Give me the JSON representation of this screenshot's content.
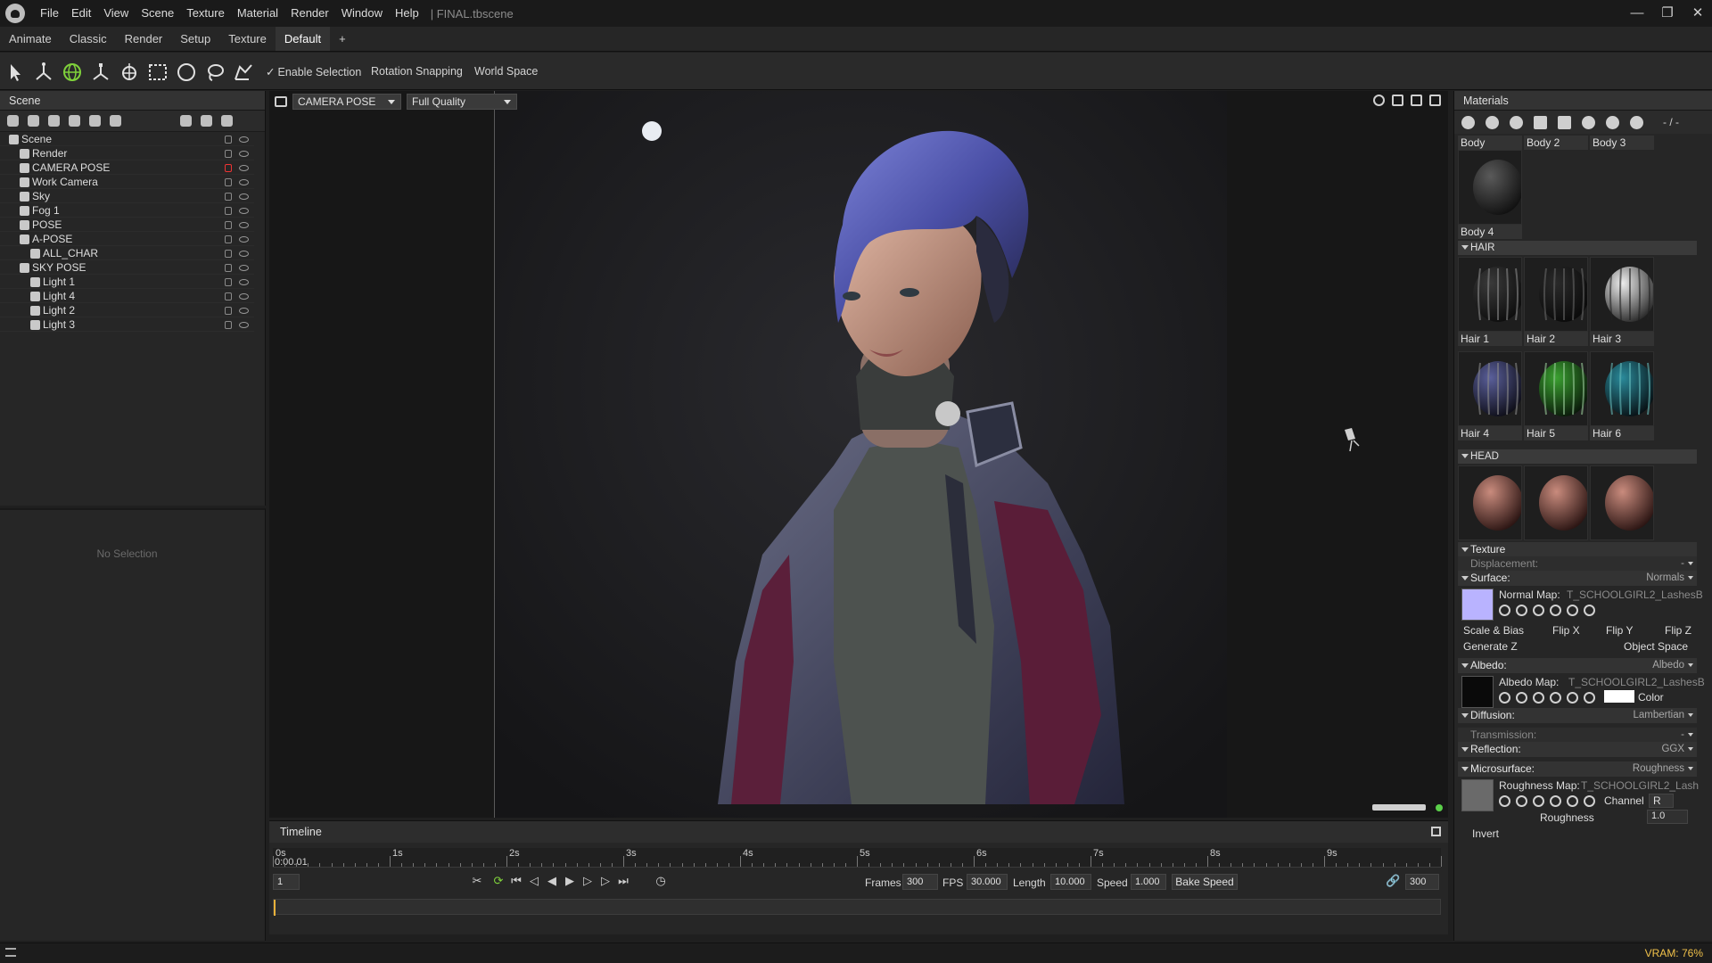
{
  "window": {
    "file_title": "| FINAL.tbscene",
    "menu": [
      "File",
      "Edit",
      "View",
      "Scene",
      "Texture",
      "Material",
      "Render",
      "Window",
      "Help"
    ]
  },
  "workspaces": [
    "Animate",
    "Classic",
    "Render",
    "Setup",
    "Texture",
    "Default",
    "+"
  ],
  "toolbar": {
    "enable_selection": "Enable Selection",
    "rotation_snapping": "Rotation Snapping",
    "world_space": "World Space"
  },
  "scene": {
    "title": "Scene",
    "items": [
      {
        "label": "Scene",
        "indent": 0,
        "lock": "normal"
      },
      {
        "label": "Render",
        "indent": 1,
        "lock": "normal"
      },
      {
        "label": "CAMERA POSE",
        "indent": 1,
        "lock": "red"
      },
      {
        "label": "Work Camera",
        "indent": 1,
        "lock": "normal"
      },
      {
        "label": "Sky",
        "indent": 1,
        "lock": "normal"
      },
      {
        "label": "Fog 1",
        "indent": 1,
        "lock": "normal"
      },
      {
        "label": "POSE",
        "indent": 1,
        "lock": "normal"
      },
      {
        "label": "A-POSE",
        "indent": 1,
        "lock": "normal"
      },
      {
        "label": "ALL_CHAR",
        "indent": 2,
        "lock": "normal"
      },
      {
        "label": "SKY POSE",
        "indent": 1,
        "lock": "normal"
      },
      {
        "label": "Light 1",
        "indent": 2,
        "lock": "normal"
      },
      {
        "label": "Light 4",
        "indent": 2,
        "lock": "normal"
      },
      {
        "label": "Light 2",
        "indent": 2,
        "lock": "normal"
      },
      {
        "label": "Light 3",
        "indent": 2,
        "lock": "normal"
      }
    ],
    "no_selection": "No Selection"
  },
  "viewport": {
    "camera": "CAMERA POSE",
    "quality": "Full Quality"
  },
  "timeline": {
    "title": "Timeline",
    "current_time": "0:00.01",
    "ticks": [
      "0s",
      "1s",
      "2s",
      "3s",
      "4s",
      "5s",
      "6s",
      "7s",
      "8s",
      "9s"
    ],
    "frame_field": "1",
    "frames_label": "Frames",
    "frames": "300",
    "fps_label": "FPS",
    "fps": "30.000",
    "length_label": "Length",
    "length": "10.000",
    "speed_label": "Speed",
    "speed": "1.000",
    "bake_speed": "Bake Speed",
    "end_frame": "300",
    "playhead_fraction": 0.0
  },
  "materials": {
    "title": "Materials",
    "counter": "- / -",
    "body_labels": [
      "Body",
      "Body 2",
      "Body 3"
    ],
    "body4": "Body 4",
    "hair_group": "HAIR",
    "hair_labels": [
      "Hair 1",
      "Hair 2",
      "Hair 3",
      "Hair 4",
      "Hair 5",
      "Hair 6"
    ],
    "head_group": "HEAD",
    "texture": "Texture",
    "displacement": "Displacement:",
    "displacement_val": "-",
    "surface": "Surface:",
    "surface_val": "Normals",
    "normal_map_label": "Normal Map:",
    "normal_map_file": "T_SCHOOLGIRL2_LashesB",
    "scale_bias": "Scale & Bias",
    "flip_x": "Flip X",
    "flip_y": "Flip Y",
    "flip_z": "Flip Z",
    "generate_z": "Generate Z",
    "object_space": "Object Space",
    "albedo": "Albedo:",
    "albedo_val": "Albedo",
    "albedo_map_label": "Albedo Map:",
    "albedo_map_file": "T_SCHOOLGIRL2_LashesB",
    "color": "Color",
    "diffusion": "Diffusion:",
    "diffusion_val": "Lambertian",
    "transmission": "Transmission:",
    "transmission_val": "-",
    "reflection": "Reflection:",
    "reflection_val": "GGX",
    "microsurface": "Microsurface:",
    "microsurface_val": "Roughness",
    "roughness_map_label": "Roughness Map:",
    "roughness_map_file": "T_SCHOOLGIRL2_Lash",
    "channel_label": "Channel",
    "channel": "R",
    "roughness": "Roughness",
    "roughness_val": "1.0",
    "invert": "Invert"
  },
  "status": {
    "vram": "VRAM: 76%"
  },
  "colors": {
    "accent": "#e8b13a",
    "vram": "#f0c14a",
    "normal_swatch": "#b9b3ff"
  }
}
